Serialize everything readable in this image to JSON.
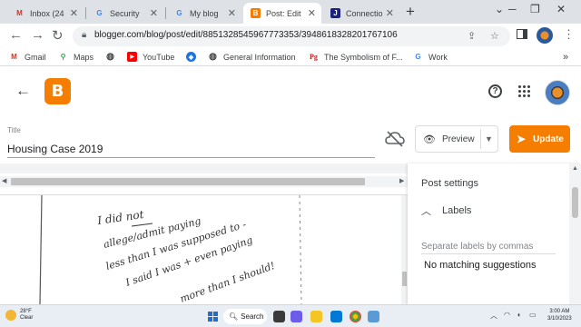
{
  "browser": {
    "tabs": [
      {
        "label": "Inbox (24",
        "icon": "gmail-icon",
        "active": false
      },
      {
        "label": "Security",
        "icon": "google-icon",
        "active": false
      },
      {
        "label": "My blog",
        "icon": "google-icon",
        "active": false
      },
      {
        "label": "Post: Edit",
        "icon": "blogger-icon",
        "active": true
      },
      {
        "label": "Connectio",
        "icon": "jstor-icon",
        "active": false
      }
    ],
    "url": "blogger.com/blog/post/edit/8851328545967773353/3948618328201767106",
    "bookmarks": [
      {
        "label": "Gmail",
        "icon": "gmail-icon"
      },
      {
        "label": "Maps",
        "icon": "maps-icon"
      },
      {
        "label": "",
        "icon": "globe-icon"
      },
      {
        "label": "YouTube",
        "icon": "youtube-icon"
      },
      {
        "label": "",
        "icon": "compass-icon"
      },
      {
        "label": "General Information",
        "icon": "globe-icon"
      },
      {
        "label": "The Symbolism of F...",
        "icon": "pg-icon"
      },
      {
        "label": "Work",
        "icon": "google-icon"
      }
    ],
    "bookmarks_overflow": "»"
  },
  "app": {
    "logo_letter": "B",
    "help_glyph": "?"
  },
  "editor": {
    "title_label": "Title",
    "title_value": "Housing Case 2019",
    "preview_label": "Preview",
    "update_label": "Update"
  },
  "document": {
    "handwritten_lines": [
      "I did not",
      "allege/admit paying",
      "less than I was supposed to -",
      "I said I was + even paying",
      "more than I should!"
    ]
  },
  "post_settings": {
    "title": "Post settings",
    "labels_heading": "Labels",
    "labels_placeholder": "Separate labels by commas",
    "no_match": "No matching suggestions"
  },
  "taskbar": {
    "weather_temp": "28°F",
    "weather_desc": "Clear",
    "search_label": "Search",
    "time": "3:00 AM",
    "date": "3/10/2023"
  },
  "colors": {
    "accent": "#f57d00",
    "title_underline": "#f08070"
  }
}
